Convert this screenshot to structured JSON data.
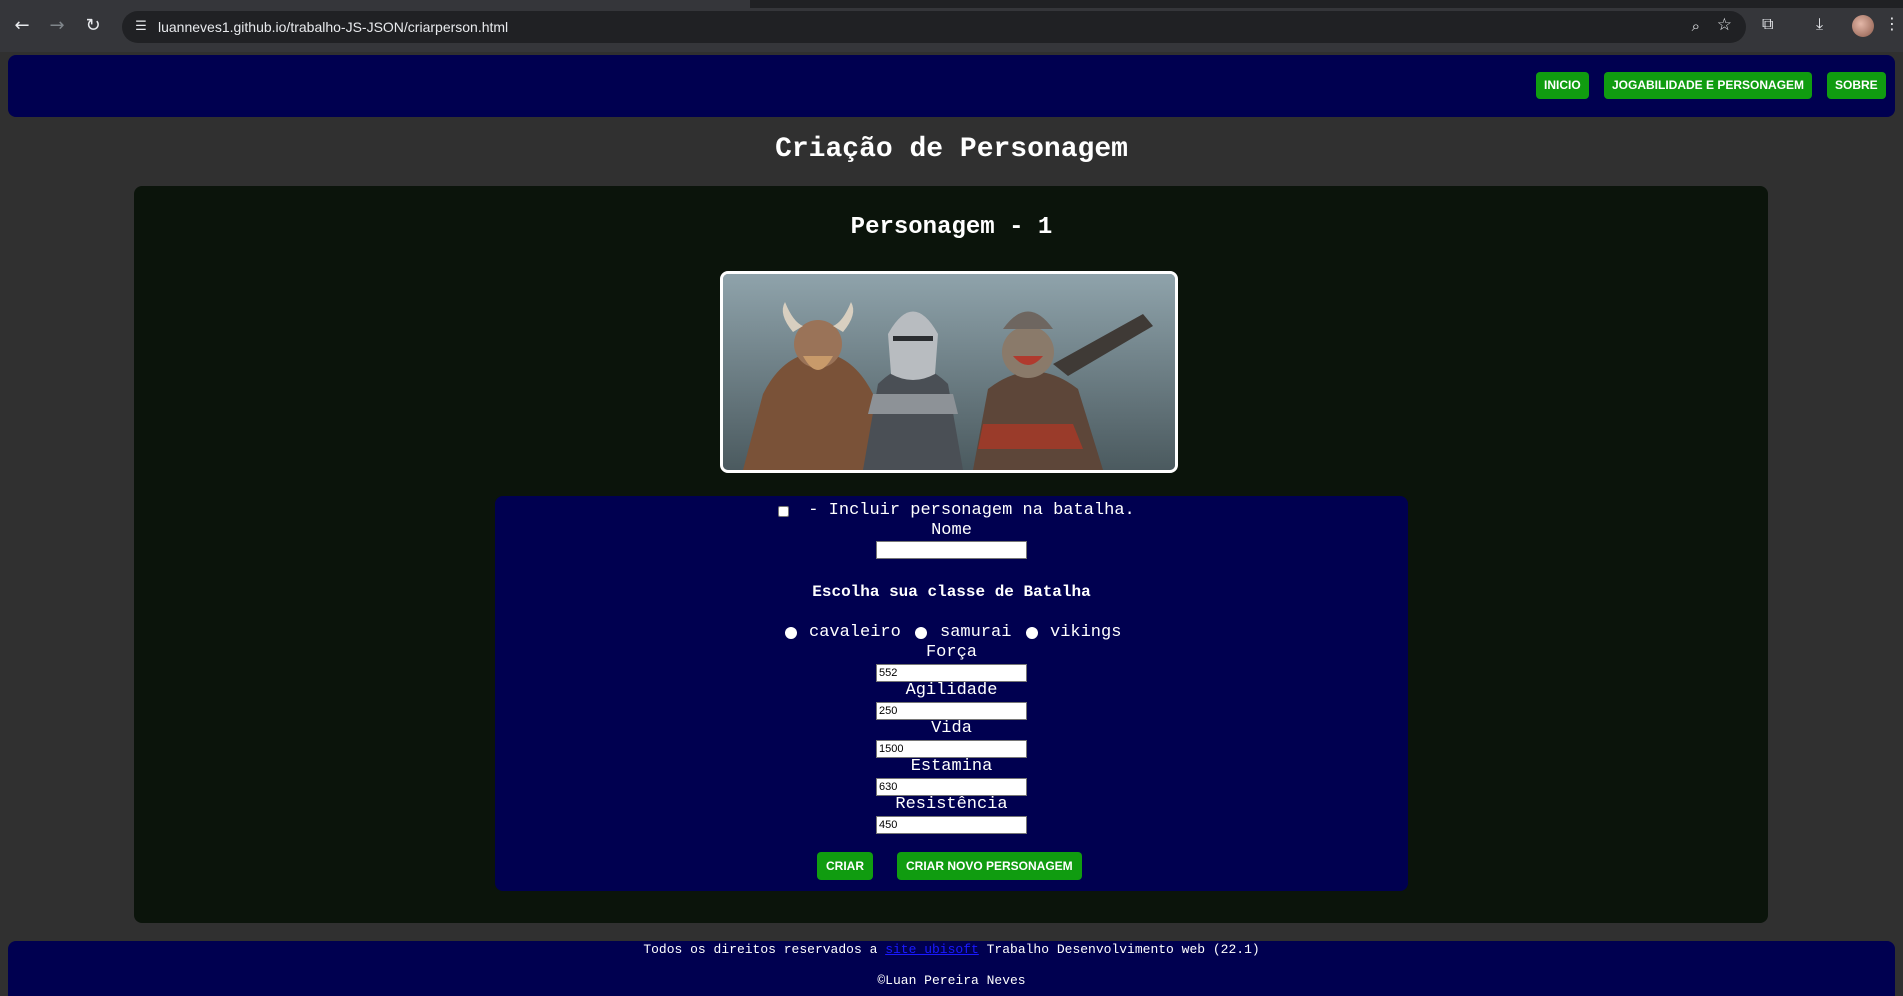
{
  "browser": {
    "url": "luanneves1.github.io/trabalho-JS-JSON/criarperson.html",
    "icons": [
      "back-icon",
      "forward-icon",
      "reload-icon",
      "site-settings-icon",
      "zoom-icon",
      "bookmark-star-icon",
      "extensions-icon",
      "download-icon",
      "profile-avatar",
      "menu-icon"
    ]
  },
  "header": {
    "nav": [
      "INICIO",
      "JOGABILIDADE E PERSONAGEM",
      "SOBRE"
    ]
  },
  "page": {
    "title": "Criação de Personagem"
  },
  "character": {
    "title": "Personagem - 1",
    "include_label": "- Incluir personagem na batalha.",
    "include_checked": false,
    "name_label": "Nome",
    "name_value": "",
    "class_heading": "Escolha sua classe de Batalha",
    "classes": [
      "cavaleiro",
      "samurai",
      "vikings"
    ],
    "stats": [
      {
        "label": "Força",
        "value": "552"
      },
      {
        "label": "Agilidade",
        "value": "250"
      },
      {
        "label": "Vida",
        "value": "1500"
      },
      {
        "label": "Estamina",
        "value": "630"
      },
      {
        "label": "Resistência",
        "value": "450"
      }
    ],
    "buttons": {
      "create": "CRIAR",
      "create_new": "CRIAR NOVO PERSONAGEM"
    }
  },
  "footer": {
    "rights_prefix": "Todos os direitos reservados a",
    "link_text": "site ubisoft",
    "rights_suffix": "Trabalho Desenvolvimento web (22.1)",
    "copyright": "©Luan Pereira Neves"
  },
  "colors": {
    "nav_bg": "#000050",
    "button_green": "#109c10",
    "panel_bg": "#0b140b",
    "page_bg": "#303030"
  }
}
